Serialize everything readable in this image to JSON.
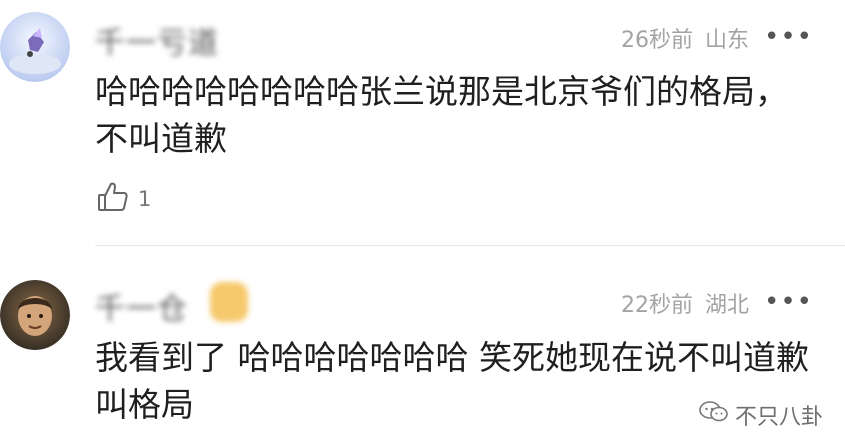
{
  "comments": [
    {
      "username": "千一亏道",
      "time": "26秒前",
      "location": "山东",
      "more": "•••",
      "content": "哈哈哈哈哈哈哈哈张兰说那是北京爷们的格局，不叫道歉",
      "likes": "1"
    },
    {
      "username": "千一仓",
      "time": "22秒前",
      "location": "湖北",
      "more": "•••",
      "content": "我看到了 哈哈哈哈哈哈哈 笑死她现在说不叫道歉 叫格局"
    }
  ],
  "watermark": {
    "text": "不只八卦"
  },
  "icons": {
    "like": "thumbs-up-icon",
    "more": "more-dots-icon",
    "watermark": "wechat-logo-icon"
  },
  "colors": {
    "meta_text": "#a3a3a3",
    "content_text": "#1f1f1f",
    "divider": "#e6e6e6"
  }
}
